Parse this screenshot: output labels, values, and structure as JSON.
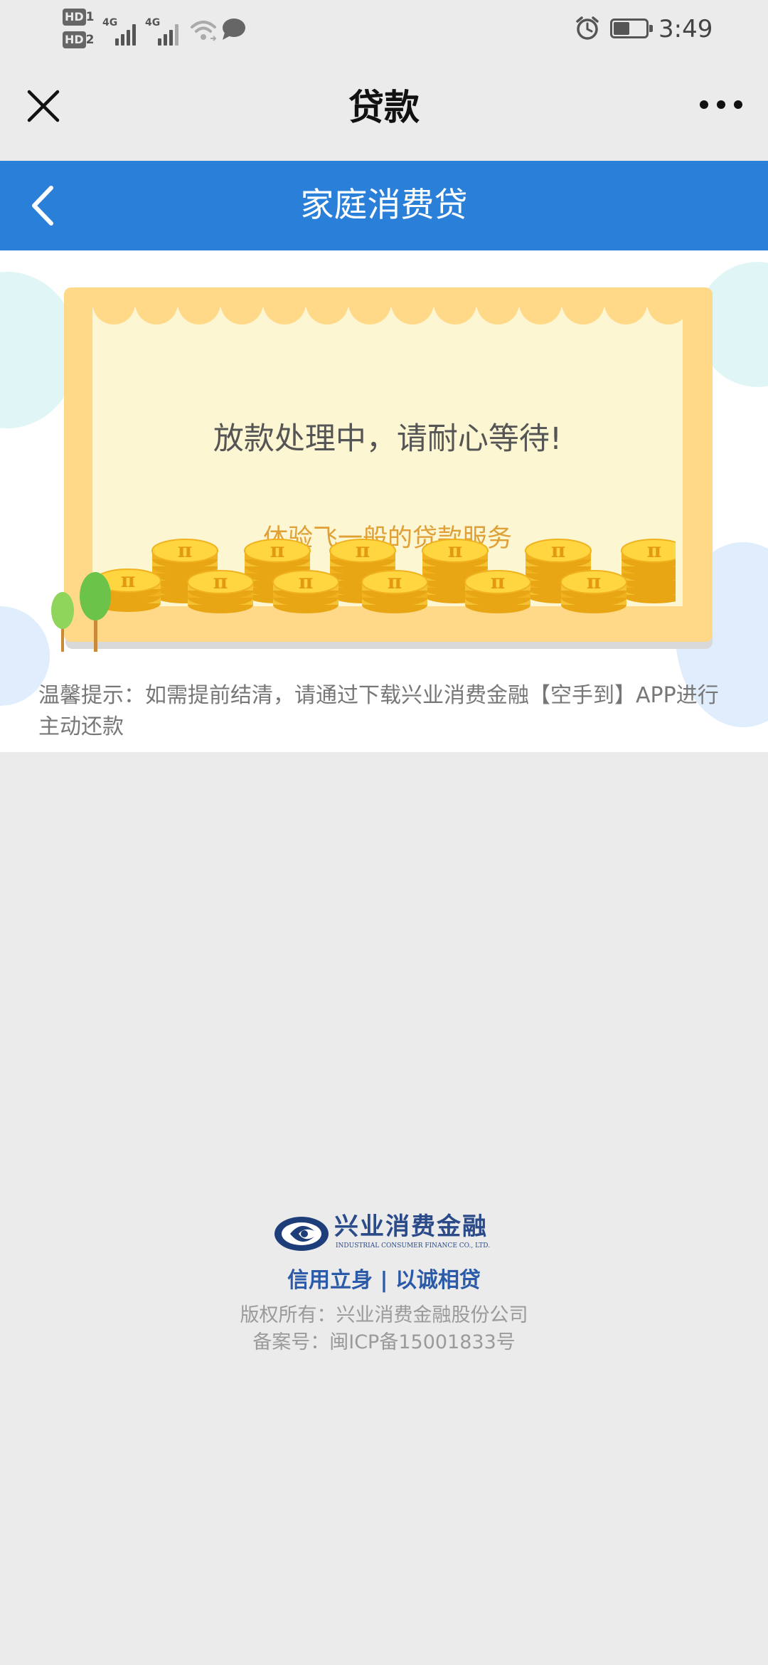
{
  "status_bar": {
    "hd1": "HD",
    "hd1_sub": "1",
    "hd2": "HD",
    "hd2_sub": "2",
    "sim1_network": "4G",
    "sim2_network": "4G",
    "time": "3:49",
    "battery_level": 0.5,
    "icons": [
      "wifi-icon",
      "chat-bubble-icon",
      "alarm-icon",
      "battery-icon"
    ]
  },
  "titlebar": {
    "title": "贷款",
    "close_icon": "close-icon",
    "more_icon": "more-icon"
  },
  "header": {
    "title": "家庭消费贷",
    "back_icon": "chevron-left-icon",
    "color": "#2a7fd9"
  },
  "card": {
    "message": "放款处理中，请耐心等待!",
    "slogan": "体验飞一般的贷款服务",
    "coin_symbol": "π"
  },
  "notice": "温馨提示：如需提前结清，请通过下载兴业消费金融【空手到】APP进行主动还款",
  "footer": {
    "brand_cn": "兴业消费金融",
    "brand_en": "INDUSTRIAL CONSUMER FINANCE CO., LTD.",
    "motto": "信用立身 | 以诚相贷",
    "copyright": "版权所有：兴业消费金融股份公司",
    "icp": "备案号：闽ICP备15001833号",
    "brand_color": "#2a4a8a"
  }
}
